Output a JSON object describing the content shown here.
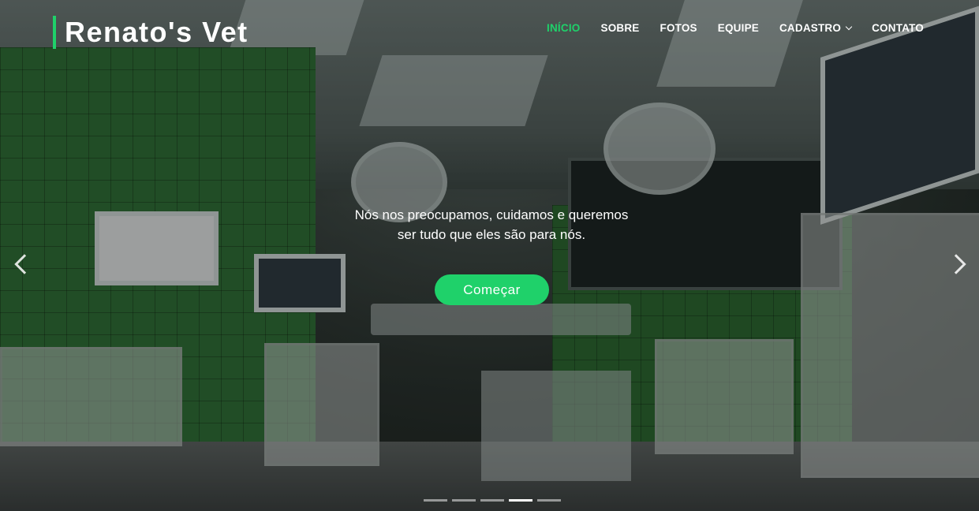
{
  "brand": {
    "name": "Renato's Vet",
    "accent_color": "#1fd16a"
  },
  "nav": {
    "items": [
      {
        "label": "INÍCIO",
        "active": true
      },
      {
        "label": "SOBRE",
        "active": false
      },
      {
        "label": "FOTOS",
        "active": false
      },
      {
        "label": "EQUIPE",
        "active": false
      },
      {
        "label": "CADASTRO",
        "active": false,
        "dropdown": true
      },
      {
        "label": "CONTATO",
        "active": false
      }
    ]
  },
  "hero": {
    "caption_line1": "Nós nos preocupamos, cuidamos e queremos",
    "caption_line2": "ser tudo que eles são para nós.",
    "cta_label": "Começar",
    "prev_icon": "chevron-left-icon",
    "next_icon": "chevron-right-icon",
    "slide_count": 5,
    "active_slide": 4
  }
}
